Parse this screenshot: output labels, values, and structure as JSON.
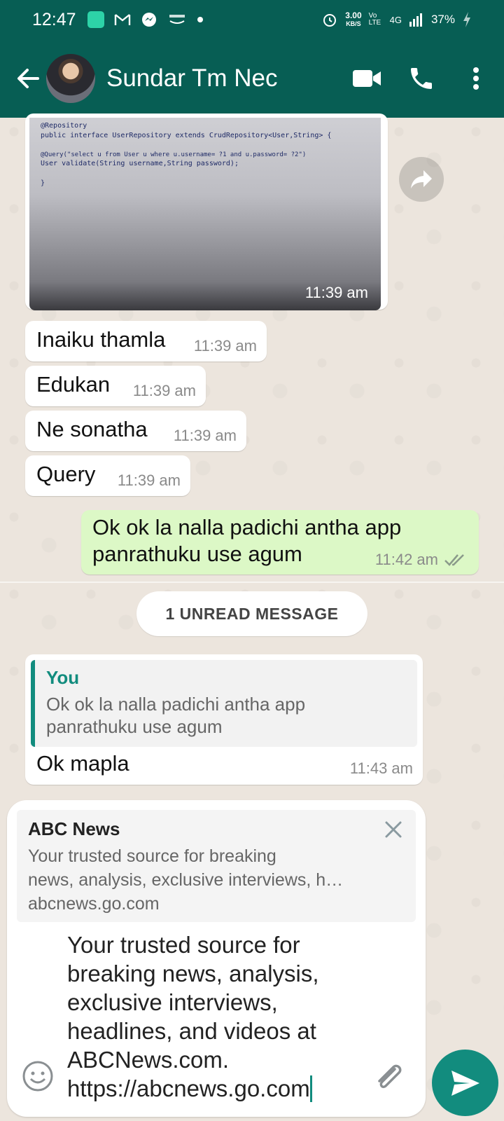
{
  "colors": {
    "header": "#075e54",
    "accent": "#128c7e",
    "outgoing": "#dcf8c6",
    "background": "#ece5dd"
  },
  "status_bar": {
    "time": "12:47",
    "speed_value": "3.00",
    "speed_unit": "KB/S",
    "network_volte": "Vo LTE",
    "network": "4G",
    "battery": "37%",
    "icons": [
      "app-icon",
      "gmail-icon",
      "messenger-icon",
      "amazon-icon",
      "dot-icon",
      "alarm-icon",
      "signal-icon",
      "charging-icon"
    ]
  },
  "header": {
    "contact_name": "Sundar Tm Nec",
    "icons": [
      "back-arrow-icon",
      "avatar",
      "video-call-icon",
      "phone-icon",
      "more-vert-icon"
    ]
  },
  "messages": {
    "image": {
      "code_lines": [
        "@Repository",
        "public interface UserRepository extends CrudRepository<User,String> {",
        "",
        "    @Query(\"select u from User u where u.username= ?1 and u.password= ?2\")",
        "    User validate(String username,String password);",
        "",
        "}"
      ],
      "time": "11:39 am"
    },
    "incoming": [
      {
        "text": "Inaiku thamla",
        "time": "11:39 am"
      },
      {
        "text": "Edukan",
        "time": "11:39 am"
      },
      {
        "text": "Ne sonatha",
        "time": "11:39 am"
      },
      {
        "text": "Query",
        "time": "11:39 am"
      }
    ],
    "outgoing": {
      "line1": "Ok ok la nalla padichi antha app",
      "line2": "panrathuku use agum",
      "time": "11:42 am"
    },
    "unread_label": "1 UNREAD MESSAGE",
    "reply": {
      "quote_author": "You",
      "quote_line1": "Ok ok la nalla padichi antha app",
      "quote_line2": "panrathuku use agum",
      "text": "Ok mapla",
      "time": "11:43 am"
    }
  },
  "compose": {
    "link_preview": {
      "title": "ABC News",
      "desc_line1": "Your trusted source for breaking",
      "desc_line2": "news, analysis, exclusive interviews, h…",
      "domain": "abcnews.go.com"
    },
    "text": "Your trusted source for\nbreaking news, analysis,\nexclusive interviews,\nheadlines, and videos at\nABCNews.com.\nhttps://abcnews.go.com"
  }
}
